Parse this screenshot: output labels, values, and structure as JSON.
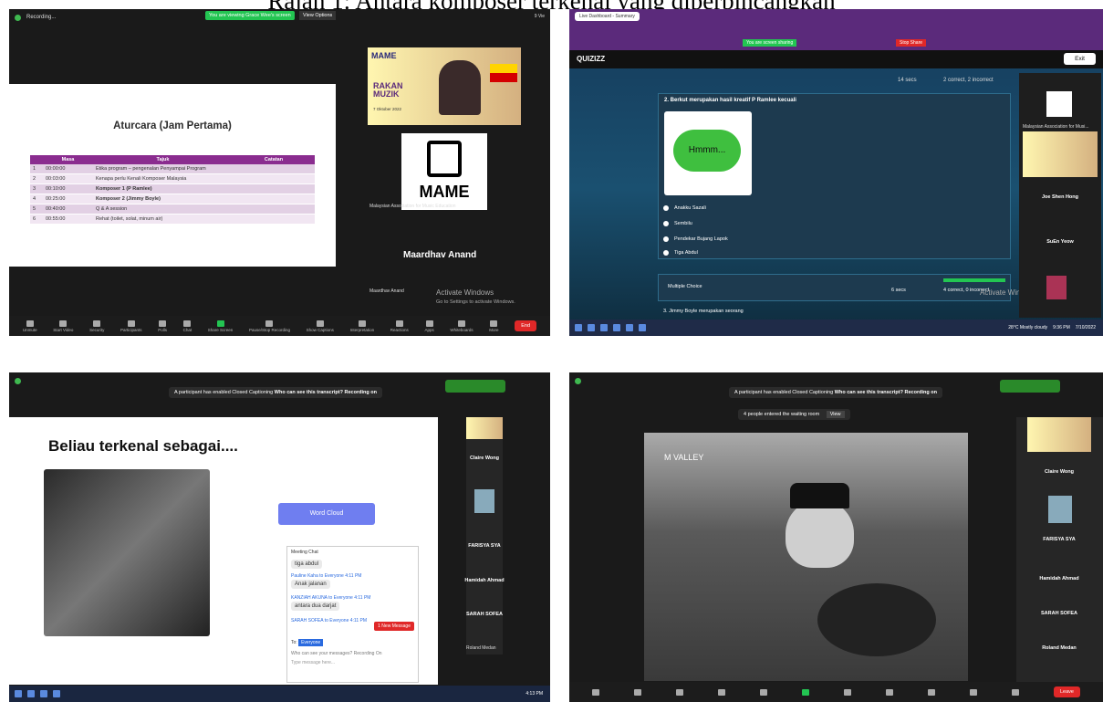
{
  "caption": "Rajah 1: Antara komposer terkenal yang diperbincangkan",
  "panel1": {
    "recording": "Recording...",
    "viewing_banner": "You are viewing Grace Wee's screen",
    "view_options": "View Options",
    "participants_top": "9 Vie",
    "slide_title": "Aturcara (Jam Pertama)",
    "table_headers": [
      "Masa",
      "Tajuk",
      "Catatan"
    ],
    "table_rows": [
      {
        "no": "1",
        "masa": "00:00:00",
        "tajuk": "Etika program – pengenalan Penyampai Program"
      },
      {
        "no": "2",
        "masa": "00:03:00",
        "tajuk": "Kenapa perlu Kenali Komposer Malaysia"
      },
      {
        "no": "3",
        "masa": "00:10:00",
        "tajuk": "Komposer 1 (P Ramlee)"
      },
      {
        "no": "4",
        "masa": "00:25:00",
        "tajuk": "Komposer 2 (Jimmy Boyle)"
      },
      {
        "no": "5",
        "masa": "00:40:00",
        "tajuk": "Q & A session"
      },
      {
        "no": "6",
        "masa": "00:55:00",
        "tajuk": "Rehat (toilet, solat, minum air)"
      }
    ],
    "card_logo": "MAME",
    "card_text": "RAKAN MUZIK",
    "card_date": "7 Oktober 2022",
    "mame_label": "Malaysian Association for Music Education",
    "speaker_name": "Maardhav Anand",
    "speaker_label": "Maardhav Anand",
    "watermark_1": "Activate Windows",
    "watermark_2": "Go to Settings to activate Windows.",
    "toolbar": [
      "Unmute",
      "Start Video",
      "Security",
      "Participants",
      "Polls",
      "Chat",
      "Share Screen",
      "Pause/Stop Recording",
      "Show Captions",
      "Interpretation",
      "Reactions",
      "Apps",
      "Whiteboards",
      "More"
    ],
    "end_label": "End"
  },
  "panel2": {
    "tab_title": "Live Dashboard - Summary",
    "screen_share": "You are screen sharing",
    "stop_share": "Stop Share",
    "brand": "QUIZIZZ",
    "exit": "Exit",
    "timer_1": "14 secs",
    "result_1": "2 correct, 2 incorrect",
    "question": "2. Berkut merupakan hasil kreatif P Ramlee kecuali",
    "hmm": "Hmmm...",
    "options": [
      "Anakku Sazali",
      "Sembilu",
      "Pendekar Bujang Lapok",
      "Tiga Abdul"
    ],
    "multi": "Multiple Choice",
    "timer_2": "6 secs",
    "result_2": "4 correct, 0 incorrect",
    "next_q": "3. Jimmy Boyle merupakan seorang",
    "p_mame": "Malaysian Association for Musi...",
    "p_names": [
      "Joe Shen Hong",
      "SuEn Yeow"
    ],
    "watermark": "Activate Windows",
    "weather": "28°C Mostly cloudy",
    "time": "9:36 PM",
    "date": "7/10/2022"
  },
  "panel3": {
    "caption_banner": "A participant has enabled Closed Captioning",
    "who_can_see": "Who can see this transcript? Recording on",
    "heading": "Beliau terkenal sebagai....",
    "word_cloud": "Word Cloud",
    "chat_title": "Meeting Chat",
    "chat_msgs": [
      {
        "from": "",
        "text": "tiga abdul"
      },
      {
        "from": "Pauline Kaha to Everyone 4:11 PM",
        "text": "Anak jalanan"
      },
      {
        "from": "KANZIAH AKUNA to Everyone 4:11 PM",
        "text": "antara dua darjat"
      },
      {
        "from": "SARAH SOFEA to Everyone 4:11 PM",
        "text": ""
      }
    ],
    "new_msg": "1 New Message",
    "to": "To:",
    "everyone": "Everyone",
    "who_msg": "Who can see your messages? Recording On",
    "type_msg": "Type message here...",
    "participants": [
      "Claire Wong",
      "Hamidah Ahmad",
      "SARAH SOFEA",
      "FARISYA SYA",
      "Roland Medan"
    ],
    "time": "4:13 PM"
  },
  "panel4": {
    "caption_banner": "A participant has enabled Closed Captioning",
    "who_can_see": "Who can see this transcript? Recording on",
    "waiting": "4 people entered the waiting room",
    "view": "View",
    "film_text": "M VALLEY",
    "participants": [
      "Claire Wong",
      "FARISYA SYA",
      "Hamidah Ahmad",
      "SARAH SOFEA",
      "Roland Medan"
    ],
    "leave": "Leave"
  }
}
